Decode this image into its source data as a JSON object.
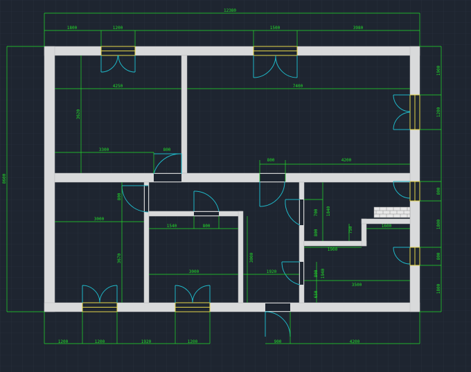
{
  "canvas": {
    "background": "#1e2530",
    "grid_color": "#2a3441",
    "wall_color": "#d9dadb",
    "dim_color": "#22e02a",
    "door_color": "#1fb8c8",
    "window_color": "#e6d64a",
    "grid_visible": true
  },
  "dimensions": {
    "top_total": "12380",
    "top_1800": "1800",
    "top_1200": "1200",
    "top_1500": "1500",
    "top_3980": "3980",
    "left_total": "8600",
    "room_a_width": "4250",
    "room_b_width": "7400",
    "room_a_height": "3620",
    "room_a_3300": "3300",
    "door_800_a": "800",
    "door_800_b": "800",
    "width_4200_mid": "4200",
    "right_1900": "1900",
    "right_1200_window": "1200",
    "right_800_a": "800",
    "right_1800": "1800",
    "right_800_b": "800",
    "right_1800_b": "1800",
    "left_800": "800",
    "left_3000": "3000",
    "left_3670": "3670",
    "room_1540": "1540",
    "room_800": "800",
    "room_3000_h": "3000",
    "room_3000_v": "3000",
    "room_1920": "1920",
    "bath_700": "700",
    "bath_1840": "1840",
    "bath_800": "800",
    "bath_750": "750",
    "bath_1600": "1600",
    "bath_1900": "1900",
    "bath_800_b": "800",
    "bath_1940": "1940",
    "bath_3500": "3500",
    "bath_650": "650",
    "bottom_1200_a": "1200",
    "bottom_1200_b": "1200",
    "bottom_1920": "1920",
    "bottom_1200_c": "1200",
    "bottom_900": "900",
    "bottom_4200": "4200"
  }
}
